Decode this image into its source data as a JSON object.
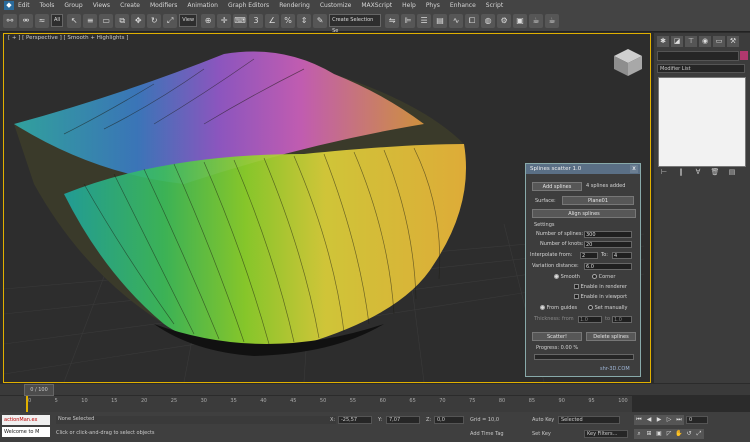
{
  "menu": {
    "items": [
      "Edit",
      "Tools",
      "Group",
      "Views",
      "Create",
      "Modifiers",
      "Animation",
      "Graph Editors",
      "Rendering",
      "Customize",
      "MAXScript",
      "Help",
      "Phys",
      "Enhance",
      "Script"
    ]
  },
  "toolbar": {
    "selection_filter": "All",
    "view_dropdown": "View",
    "named_sets": "Create Selection Se"
  },
  "viewport": {
    "label": "[ + ] [ Perspective ] [ Smooth + Highlights ]"
  },
  "command_panel": {
    "modifier_list": "Modifier List"
  },
  "dialog": {
    "title": "Splines scatter 1.0",
    "close": "x",
    "add_splines": "Add splines",
    "splines_added": "4 splines added",
    "surface_label": "Surface:",
    "surface_value": "Plane01",
    "align_splines": "Align splines",
    "settings_header": "Settings",
    "num_splines_label": "Number of splines:",
    "num_splines_value": "300",
    "num_knots_label": "Number of knots:",
    "num_knots_value": "20",
    "interpolate_from_label": "Interpolate from:",
    "interpolate_from_value": "2",
    "interpolate_to_label": "To:",
    "interpolate_to_value": "4",
    "variation_label": "Variation distance:",
    "variation_value": "6.0",
    "smooth_label": "Smooth",
    "corner_label": "Corner",
    "enable_renderer_label": "Enable in renderer",
    "enable_viewport_label": "Enable in viewport",
    "from_guides_label": "From guides",
    "set_manually_label": "Set manually",
    "thickness_label": "Thickness: from",
    "thickness_from": "1.0",
    "thickness_to_label": "to",
    "thickness_to": "1.0",
    "scatter_button": "Scatter!",
    "delete_button": "Delete splines",
    "progress_label": "Progress: 0.00 %",
    "footer": "shr-3D.COM"
  },
  "timeline": {
    "frame_indicator": "0 / 100",
    "ticks": [
      "0",
      "5",
      "10",
      "15",
      "20",
      "25",
      "30",
      "35",
      "40",
      "45",
      "50",
      "55",
      "60",
      "65",
      "70",
      "75",
      "80",
      "85",
      "90",
      "95",
      "100"
    ]
  },
  "status": {
    "maxscript_line1": "actionMan.ex",
    "maxscript_line2": "Welcome to M",
    "selection_status": "None Selected",
    "prompt": "Click or click-and-drag to select objects",
    "x_label": "X:",
    "x_value": "-25,57",
    "y_label": "Y:",
    "y_value": "7,07",
    "z_label": "Z:",
    "z_value": "0,0",
    "grid": "Grid = 10,0",
    "add_time_tag": "Add Time Tag",
    "auto_key": "Auto Key",
    "auto_key_selected": "Selected",
    "set_key": "Set Key",
    "key_filters": "Key Filters...",
    "frame_value": "0"
  },
  "colors": {
    "viewport_border": "#e0b000",
    "accent_swatch": "#b0386e",
    "dialog_title": "#5a6f85"
  }
}
